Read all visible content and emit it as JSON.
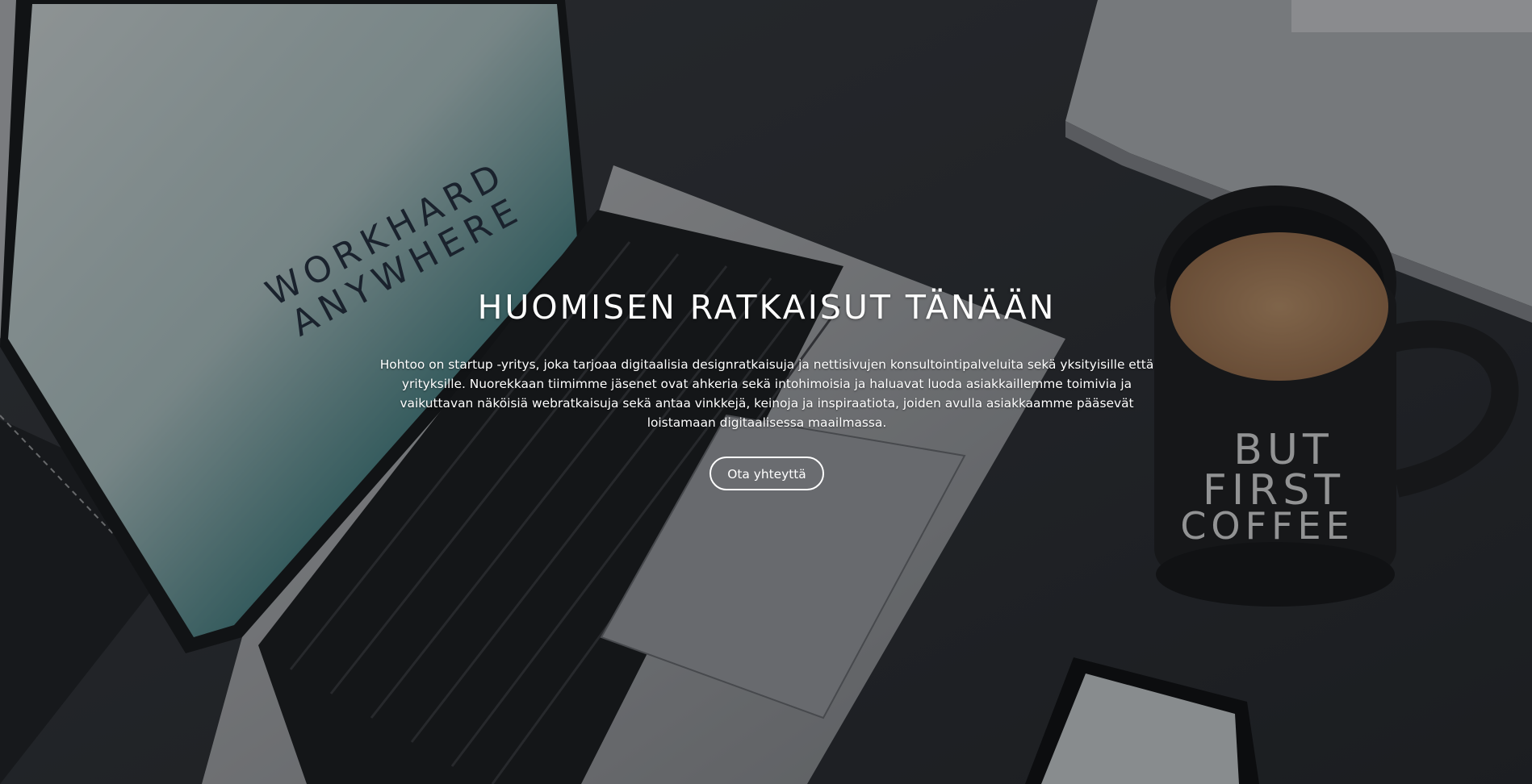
{
  "hero": {
    "title": "HUOMISEN RATKAISUT TÄNÄÄN",
    "description": "Hohtoo on startup -yritys, joka tarjoaa digitaalisia designratkaisuja ja nettisivujen konsultointipalveluita sekä yksityisille että yrityksille. Nuorekkaan tiimimme jäsenet ovat ahkeria sekä intohimoisia ja haluavat luoda asiakkaillemme toimivia ja vaikuttavan näköisiä webratkaisuja sekä antaa vinkkejä, keinoja ja inspiraatiota, joiden avulla asiakkaamme pääsevät loistamaan digitaalisessa maailmassa.",
    "cta_label": "Ota yhteyttä"
  },
  "background": {
    "screen_text_line1": "WORKHARD",
    "screen_text_line2": "ANYWHERE",
    "mug_line1": "BUT",
    "mug_line2": "FIRST",
    "mug_line3": "COFFEE",
    "colors": {
      "desk": "#2b2d31",
      "overlay": "rgba(10,12,16,0.38)",
      "text": "#ffffff"
    }
  }
}
